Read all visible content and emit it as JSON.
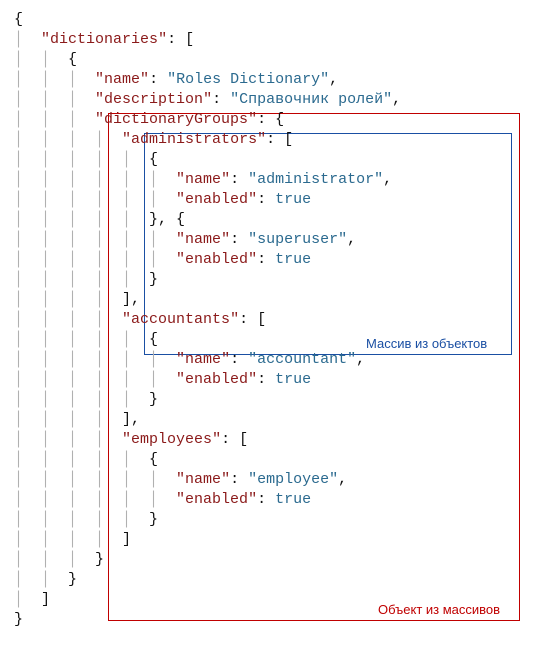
{
  "json": {
    "rootKey": "dictionaries",
    "nameKey": "name",
    "descriptionKey": "description",
    "dictGroupsKey": "dictionaryGroups",
    "enabledKey": "enabled",
    "trueLiteral": "true",
    "dictName": "Roles Dictionary",
    "dictDescription": "Справочник ролей",
    "groups": {
      "administrators": {
        "key": "administrators",
        "items": [
          {
            "name": "administrator",
            "enabled": "true"
          },
          {
            "name": "superuser",
            "enabled": "true"
          }
        ]
      },
      "accountants": {
        "key": "accountants",
        "items": [
          {
            "name": "accountant",
            "enabled": "true"
          }
        ]
      },
      "employees": {
        "key": "employees",
        "items": [
          {
            "name": "employee",
            "enabled": "true"
          }
        ]
      }
    }
  },
  "annotations": {
    "arrayOfObjects": "Массив из объектов",
    "objectOfArrays": "Объект из массивов"
  },
  "colors": {
    "key": "#8b1a1a",
    "string": "#2b6a8f",
    "keyword": "#2b6a8f",
    "guide": "#b0b0b0",
    "redBox": "#c00000",
    "blueBox": "#1a4fa3"
  }
}
